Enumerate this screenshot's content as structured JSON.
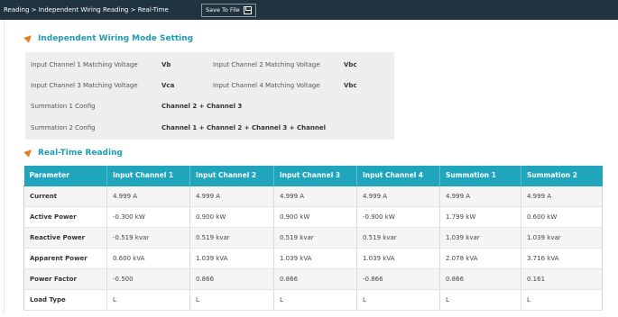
{
  "breadcrumb": "Reading > Independent Wiring Reading > Real-Time",
  "toolbar": {
    "save_label": "Save To File",
    "save_icon": "floppy-disk-icon"
  },
  "section1": {
    "title": "Independent Wiring Mode Setting"
  },
  "settings": {
    "ch1_label": "Input Channel 1 Matching Voltage",
    "ch1_value": "Vb",
    "ch2_label": "Input Channel 2 Matching Voltage",
    "ch2_value": "Vbc",
    "ch3_label": "Input Channel 3 Matching Voltage",
    "ch3_value": "Vca",
    "ch4_label": "Input Channel 4 Matching Voltage",
    "ch4_value": "Vbc",
    "sum1_label": "Summation 1 Config",
    "sum1_value": "Channel 2 + Channel 3",
    "sum2_label": "Summation 2 Config",
    "sum2_value": "Channel 1 + Channel 2 + Channel 3 + Channel"
  },
  "section2": {
    "title": "Real-Time Reading"
  },
  "table": {
    "headers": [
      "Parameter",
      "Input Channel 1",
      "Input Channel 2",
      "Input Channel 3",
      "Input Channel 4",
      "Summation 1",
      "Summation 2"
    ],
    "rows": [
      [
        "Current",
        "4.999 A",
        "4.999 A",
        "4.999 A",
        "4.999 A",
        "4.999 A",
        "4.999 A"
      ],
      [
        "Active Power",
        "-0.300 kW",
        "0.900 kW",
        "0.900 kW",
        "-0.900 kW",
        "1.799 kW",
        "0.600 kW"
      ],
      [
        "Reactive Power",
        "-0.519 kvar",
        "0.519 kvar",
        "0.519 kvar",
        "0.519 kvar",
        "1.039 kvar",
        "1.039 kvar"
      ],
      [
        "Apparent Power",
        "0.600 kVA",
        "1.039 kVA",
        "1.039 kVA",
        "1.039 kVA",
        "2.078 kVA",
        "3.716 kVA"
      ],
      [
        "Power Factor",
        "-0.500",
        "0.866",
        "0.866",
        "-0.866",
        "0.866",
        "0.161"
      ],
      [
        "Load Type",
        "L",
        "L",
        "L",
        "L",
        "L",
        "L"
      ]
    ]
  },
  "colors": {
    "accent": "#1fa6bd",
    "header_bar": "#20343f",
    "section_icon": "#e27c1c",
    "title": "#1f9cb3"
  }
}
